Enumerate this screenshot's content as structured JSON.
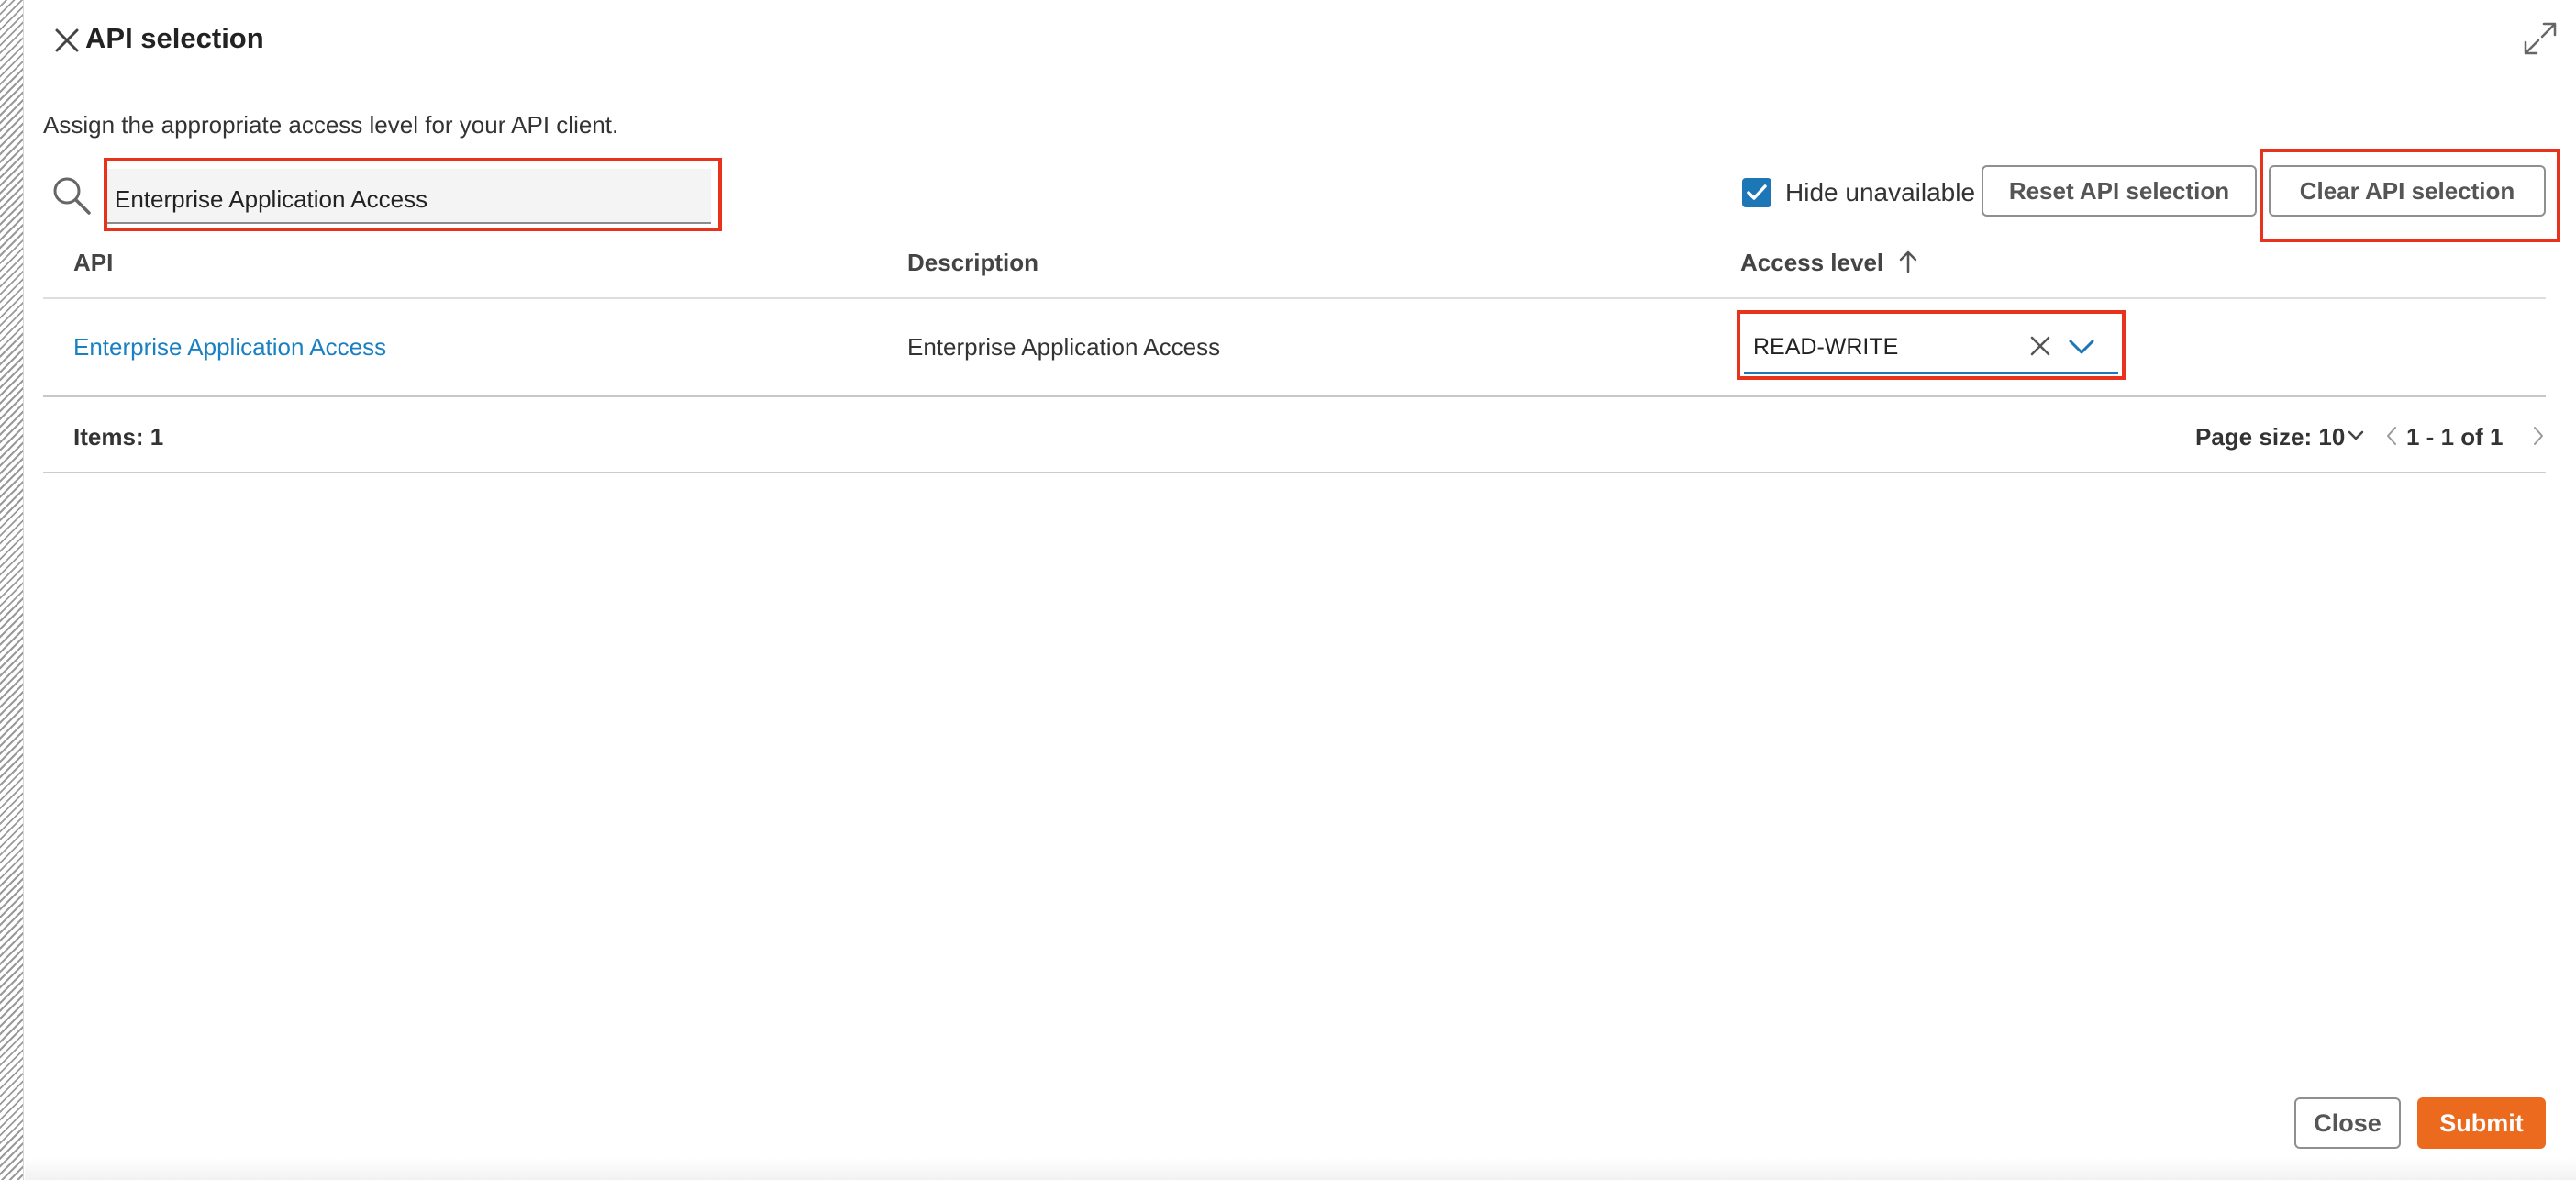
{
  "header": {
    "title": "API selection",
    "subtitle": "Assign the appropriate access level for your API client."
  },
  "search": {
    "value": "Enterprise Application Access",
    "placeholder": ""
  },
  "toolbar": {
    "hide_unavailable_label": "Hide unavailable",
    "hide_unavailable_checked": true,
    "reset_label": "Reset API selection",
    "clear_label": "Clear API selection"
  },
  "table": {
    "columns": [
      "API",
      "Description",
      "Access level"
    ],
    "rows": [
      {
        "api": "Enterprise Application Access",
        "description": "Enterprise Application Access",
        "access_level": "READ-WRITE"
      }
    ]
  },
  "footer": {
    "items_label": "Items: 1",
    "page_size_label": "Page size: 10",
    "range_label": "1 - 1 of 1"
  },
  "actions": {
    "close_label": "Close",
    "submit_label": "Submit"
  },
  "colors": {
    "accent": "#1d76b6",
    "link": "#1a80c4",
    "submit": "#ec6a1e",
    "highlight": "#e8321c"
  }
}
